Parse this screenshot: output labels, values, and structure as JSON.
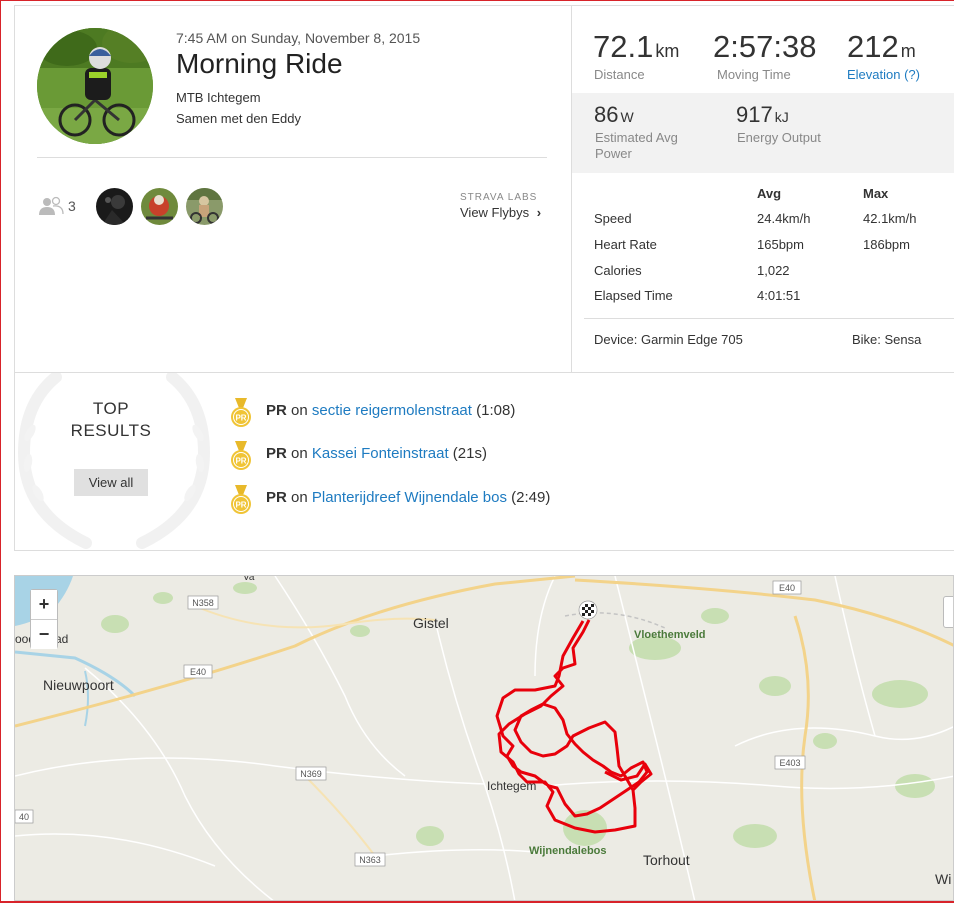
{
  "activity": {
    "date": "7:45 AM on Sunday, November 8, 2015",
    "title": "Morning Ride",
    "description_line1": "MTB Ichtegem",
    "description_line2": "Samen met den Eddy"
  },
  "social": {
    "kudos_count": "3",
    "labs_label": "STRAVA LABS",
    "flyby_label": "View Flybys",
    "flyby_chevron": "›"
  },
  "stats": {
    "distance_value": "72.1",
    "distance_unit": "km",
    "distance_label": "Distance",
    "moving_time_value": "2:57:38",
    "moving_time_label": "Moving Time",
    "elevation_value": "212",
    "elevation_unit": "m",
    "elevation_label": "Elevation (?)",
    "power_value": "86",
    "power_unit": "W",
    "power_label_1": "Estimated Avg",
    "power_label_2": "Power",
    "energy_value": "917",
    "energy_unit": "kJ",
    "energy_label": "Energy Output"
  },
  "table": {
    "col_avg": "Avg",
    "col_max": "Max",
    "rows": [
      {
        "label": "Speed",
        "avg": "24.4km/h",
        "max": "42.1km/h"
      },
      {
        "label": "Heart Rate",
        "avg": "165bpm",
        "max": "186bpm"
      },
      {
        "label": "Calories",
        "avg": "1,022",
        "max": ""
      },
      {
        "label": "Elapsed Time",
        "avg": "4:01:51",
        "max": ""
      }
    ]
  },
  "gear": {
    "device": "Device: Garmin Edge 705",
    "bike": "Bike: Sensa"
  },
  "top_results": {
    "title_line1": "TOP",
    "title_line2": "RESULTS",
    "view_all": "View all",
    "medal_text": "PR",
    "items": [
      {
        "pr": "PR",
        "on": "on",
        "segment": "sectie reigermolenstraat",
        "time": "(1:08)"
      },
      {
        "pr": "PR",
        "on": "on",
        "segment": "Kassei Fonteinstraat",
        "time": "(21s)"
      },
      {
        "pr": "PR",
        "on": "on",
        "segment": "Planterijdreef Wijnendale bos",
        "time": "(2:49)"
      }
    ]
  },
  "map": {
    "zoom_in": "+",
    "zoom_out": "−",
    "places": [
      "Gistel",
      "Nieuwpoort",
      "Ichtegem",
      "Torhout",
      "Vloethemveld",
      "Wijnendalebos",
      "Wi",
      "ood",
      "ad",
      "Va"
    ],
    "roads": [
      "N358",
      "E40",
      "E40",
      "N369",
      "E403",
      "N363",
      "40"
    ],
    "colors": {
      "route": "#e8000b",
      "land": "#ecebe4",
      "water": "#a8d3e6",
      "green": "#c5deb0",
      "road": "#ffffff",
      "highway": "#f3d38a"
    }
  }
}
